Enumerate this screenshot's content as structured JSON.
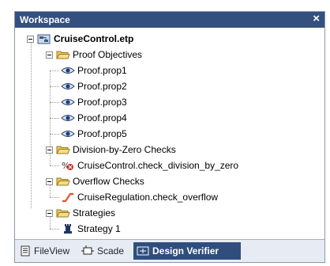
{
  "panel": {
    "title": "Workspace",
    "close_glyph": "×"
  },
  "tree": {
    "root": {
      "label": "CruiseControl.etp",
      "icon": "project-icon"
    },
    "proof_objectives": {
      "label": "Proof Objectives",
      "items": [
        "Proof.prop1",
        "Proof.prop2",
        "Proof.prop3",
        "Proof.prop4",
        "Proof.prop5"
      ]
    },
    "division_checks": {
      "label": "Division-by-Zero Checks",
      "item": "CruiseControl.check_division_by_zero"
    },
    "overflow_checks": {
      "label": "Overflow Checks",
      "item": "CruiseRegulation.check_overflow"
    },
    "strategies": {
      "label": "Strategies",
      "item": "Strategy 1"
    }
  },
  "tabs": [
    {
      "label": "FileView",
      "icon": "file-view-icon"
    },
    {
      "label": "Scade",
      "icon": "scade-icon"
    },
    {
      "label": "Design Verifier",
      "icon": "design-verifier-icon",
      "active": true
    }
  ],
  "colors": {
    "titlebar": "#33507f",
    "active_tab": "#2f4e7e",
    "folder": "#e8c860"
  }
}
